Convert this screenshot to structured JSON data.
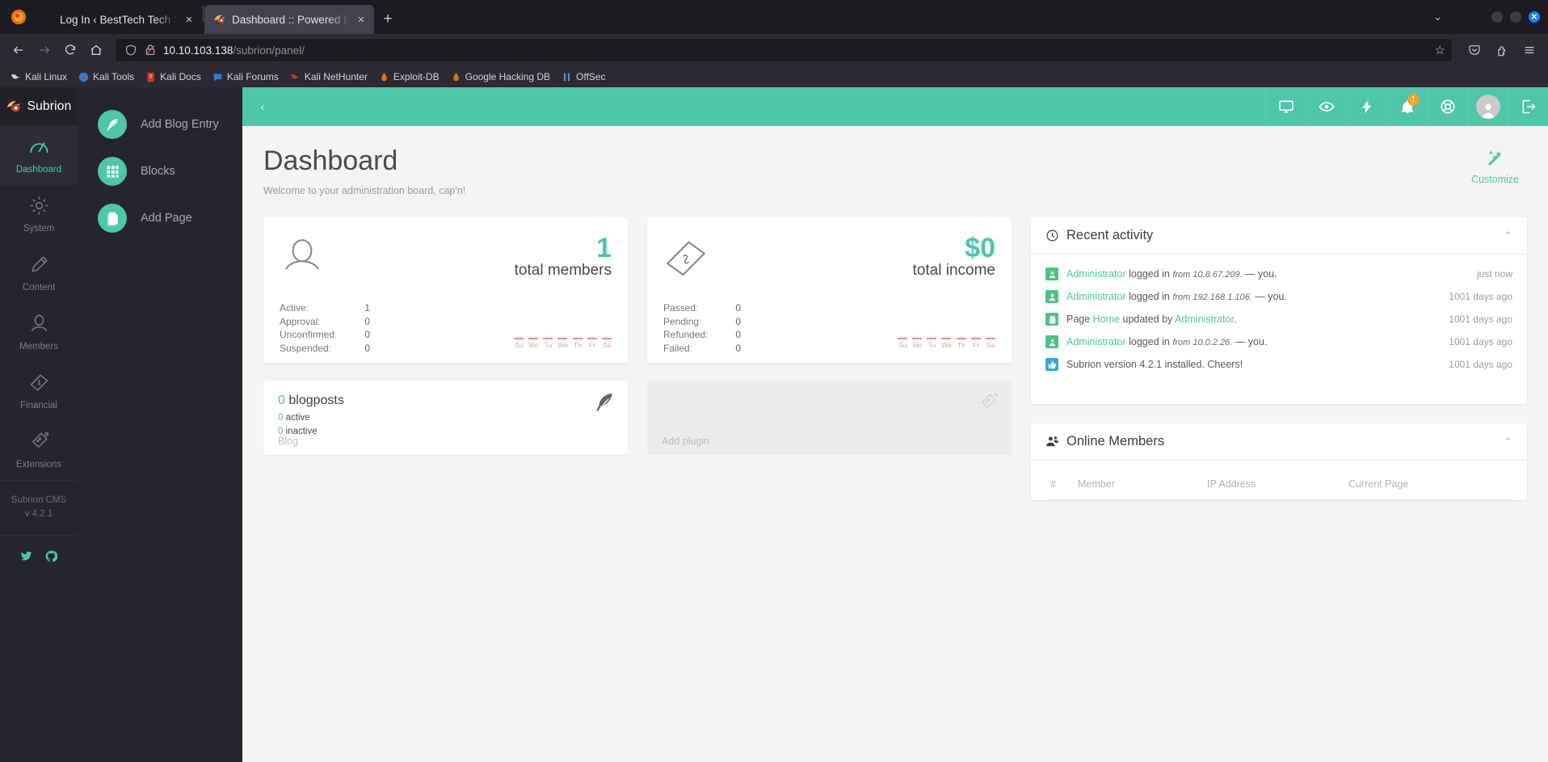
{
  "browser": {
    "tabs": [
      {
        "title": "Log In ‹ BestTech Tech Suppo",
        "close": "×",
        "favicon": ""
      },
      {
        "title": "Dashboard :: Powered by S",
        "close": "×",
        "favicon": "subrion-favicon"
      }
    ],
    "new_tab_label": "+",
    "list_all_tabs": "⌄",
    "window_controls": {
      "minimize": "",
      "maximize": "",
      "close": "✕"
    },
    "nav": {
      "back": "←",
      "forward": "→",
      "reload": "↻",
      "home": "⌂"
    },
    "url": {
      "host": "10.10.103.138",
      "path": "/subrion/panel/",
      "star": "☆"
    },
    "bookmarks": [
      {
        "label": "Kali Linux"
      },
      {
        "label": "Kali Tools"
      },
      {
        "label": "Kali Docs"
      },
      {
        "label": "Kali Forums"
      },
      {
        "label": "Kali NetHunter"
      },
      {
        "label": "Exploit-DB"
      },
      {
        "label": "Google Hacking DB"
      },
      {
        "label": "OffSec"
      }
    ]
  },
  "sidebar": {
    "brand": "Subrion",
    "items": [
      {
        "label": "Dashboard",
        "icon": "gauge-icon",
        "active": true
      },
      {
        "label": "System",
        "icon": "gear-icon",
        "active": false
      },
      {
        "label": "Content",
        "icon": "pencil-icon",
        "active": false
      },
      {
        "label": "Members",
        "icon": "user-icon",
        "active": false
      },
      {
        "label": "Financial",
        "icon": "money-icon",
        "active": false
      },
      {
        "label": "Extensions",
        "icon": "flask-icon",
        "active": false
      }
    ],
    "version_name": "Subrion CMS",
    "version_number": "v 4.2.1",
    "social": [
      {
        "name": "twitter-icon"
      },
      {
        "name": "github-icon"
      }
    ]
  },
  "quick_panel": {
    "items": [
      {
        "label": "Add Blog Entry",
        "icon": "feather-icon"
      },
      {
        "label": "Blocks",
        "icon": "grid-icon"
      },
      {
        "label": "Add Page",
        "icon": "page-icon"
      }
    ]
  },
  "topbar": {
    "collapse": "‹",
    "icons": [
      {
        "name": "monitor-icon",
        "badge": ""
      },
      {
        "name": "eye-icon",
        "badge": ""
      },
      {
        "name": "bolt-icon",
        "badge": ""
      },
      {
        "name": "bell-icon",
        "badge": "1"
      },
      {
        "name": "lifebuoy-icon",
        "badge": ""
      },
      {
        "name": "avatar-icon",
        "badge": ""
      },
      {
        "name": "logout-icon",
        "badge": ""
      }
    ]
  },
  "page": {
    "title": "Dashboard",
    "subtitle": "Welcome to your administration board, cap'n!",
    "customize_label": "Customize"
  },
  "cards": {
    "members": {
      "number": "1",
      "caption": "total members",
      "rows": [
        {
          "key": "Active",
          "value": "1"
        },
        {
          "key": "Approval",
          "value": "0"
        },
        {
          "key": "Unconfirmed",
          "value": "0"
        },
        {
          "key": "Suspended",
          "value": "0"
        }
      ],
      "spark_labels": [
        "Su",
        "Mo",
        "Tu",
        "We",
        "Th",
        "Fr",
        "Sa"
      ]
    },
    "income": {
      "number": "$0",
      "caption": "total income",
      "rows": [
        {
          "key": "Passed",
          "value": "0"
        },
        {
          "key": "Pending",
          "value": "0"
        },
        {
          "key": "Refunded",
          "value": "0"
        },
        {
          "key": "Failed",
          "value": "0"
        }
      ],
      "spark_labels": [
        "Su",
        "Mo",
        "Tu",
        "We",
        "Th",
        "Fr",
        "Sa"
      ]
    },
    "blog": {
      "count": "0",
      "title": "blogposts",
      "active_count": "0",
      "active_label": "active",
      "inactive_count": "0",
      "inactive_label": "inactive",
      "footer": "Blog"
    },
    "add_plugin": {
      "footer": "Add plugin"
    }
  },
  "recent_activity": {
    "title": "Recent activity",
    "toggle": "⌃",
    "rows": [
      {
        "icon": "user-badge-icon",
        "actor": "Administrator",
        "action": " logged in ",
        "detail": "from 10.8.67.209.",
        "tail": " — you.",
        "time": "just now"
      },
      {
        "icon": "user-badge-icon",
        "actor": "Administrator",
        "action": " logged in ",
        "detail": "from 192.168.1.106.",
        "tail": " — you.",
        "time": "1001 days ago"
      },
      {
        "icon": "page-badge-icon",
        "actor": "",
        "action": "Page ",
        "link": "Home",
        "action2": " updated by ",
        "link2": "Administrator",
        "tail": ".",
        "time": "1001 days ago"
      },
      {
        "icon": "user-badge-icon",
        "actor": "Administrator",
        "action": " logged in ",
        "detail": "from 10.0.2.26.",
        "tail": " — you.",
        "time": "1001 days ago"
      },
      {
        "icon": "thumb-badge-icon",
        "actor": "",
        "action": "Subrion version 4.2.1 installed. Cheers!",
        "time": "1001 days ago"
      }
    ]
  },
  "online_members": {
    "title": "Online Members",
    "toggle": "⌃",
    "columns": [
      "#",
      "Member",
      "IP Address",
      "Current Page"
    ],
    "rows": []
  },
  "colors": {
    "accent": "#4ec6a8",
    "sidebar_bg": "#25252d",
    "page_bg": "#f4f4f4",
    "badge_orange": "#f0a132",
    "link": "#4ec6a8"
  }
}
